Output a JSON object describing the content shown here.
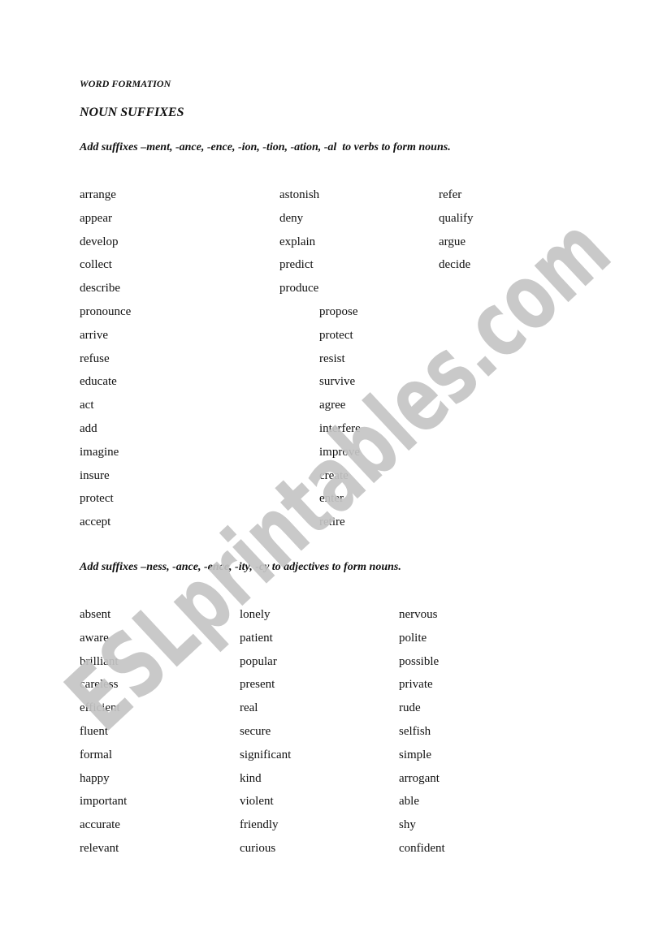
{
  "document": {
    "header": "WORD FORMATION",
    "title": "NOUN SUFFIXES",
    "watermark": "ESLprintables.com",
    "watermark_color": "#c4c4c4",
    "sections": [
      {
        "instruction": "Add suffixes –ment, -ance, -ence, -ion, -tion, -ation, -al  to verbs to form nouns.",
        "columns": [
          [
            "arrange",
            "appear",
            "develop",
            "collect",
            "describe",
            "pronounce",
            "arrive",
            "refuse",
            "educate",
            "act",
            "add",
            "imagine",
            "insure",
            "protect",
            "accept"
          ],
          [
            "astonish",
            "deny",
            "explain",
            "predict",
            "produce"
          ],
          [
            "propose",
            "protect",
            "resist",
            "survive",
            "agree",
            "interfere",
            "improve",
            "create",
            "enter",
            "retire"
          ],
          [
            "refer",
            "qualify",
            "argue",
            "decide"
          ]
        ]
      },
      {
        "instruction": "Add suffixes –ness, -ance, -ence, -ity, -cy to adjectives to form nouns.",
        "columns": [
          [
            "absent",
            "aware",
            "brilliant",
            "careless",
            "efficient",
            "fluent",
            "formal",
            "happy",
            "important",
            "accurate",
            "relevant"
          ],
          [
            "lonely",
            "patient",
            "popular",
            "present",
            "real",
            "secure",
            "significant",
            "kind",
            "violent",
            "friendly",
            "curious"
          ],
          [
            "nervous",
            "polite",
            "possible",
            "private",
            "rude",
            "selfish",
            "simple",
            "arrogant",
            "able",
            "shy",
            "confident"
          ]
        ]
      }
    ]
  }
}
